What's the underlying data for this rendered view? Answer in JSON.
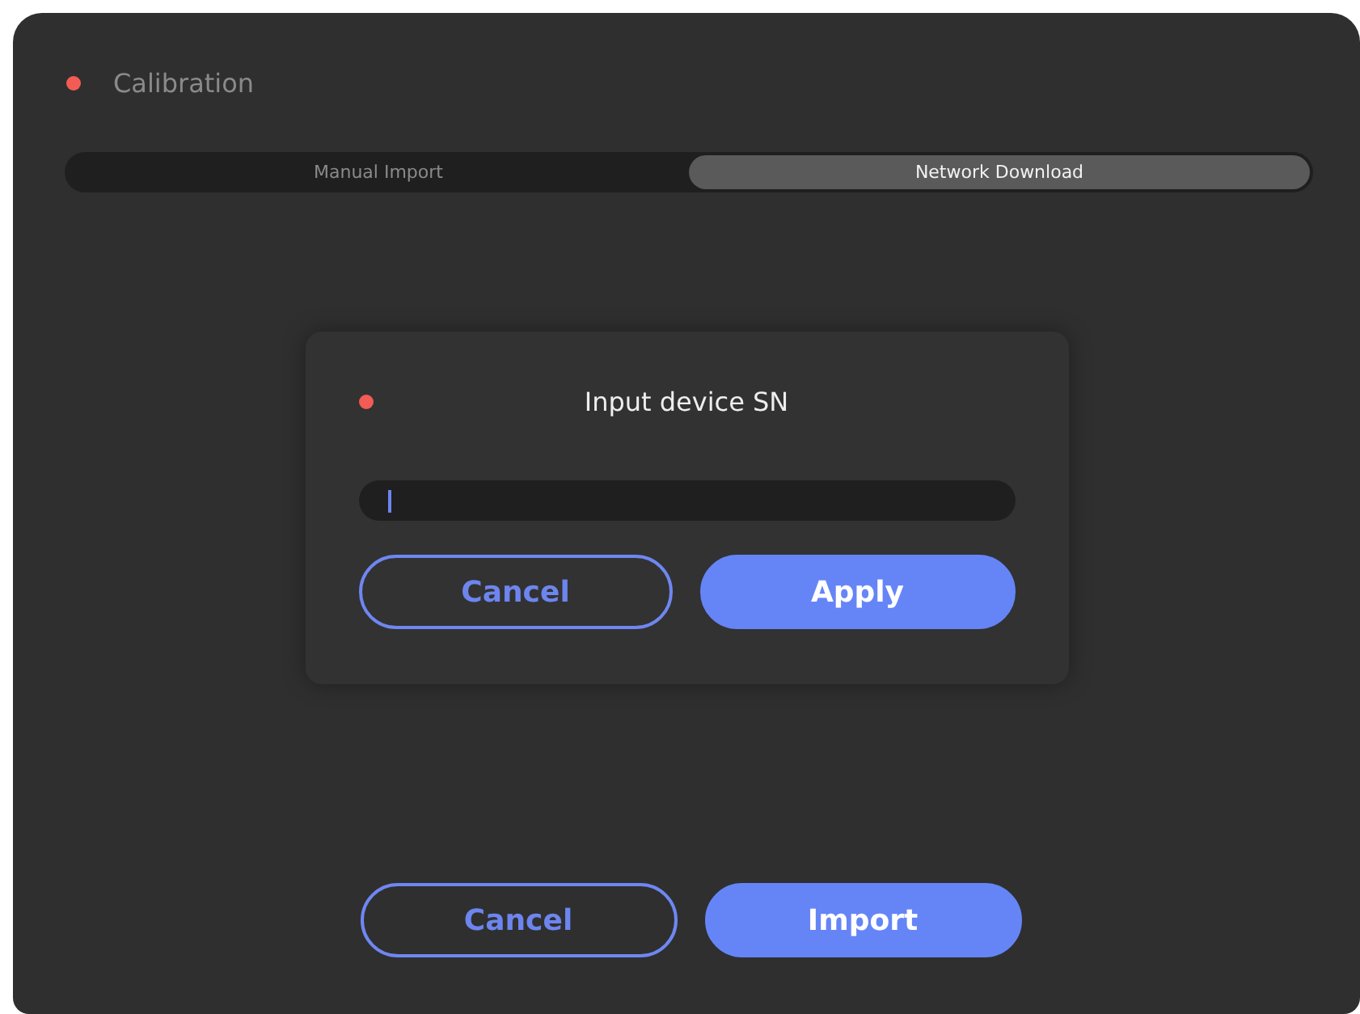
{
  "window": {
    "title": "Calibration"
  },
  "tabs": [
    {
      "label": "Manual Import",
      "selected": false
    },
    {
      "label": "Network Download",
      "selected": true
    }
  ],
  "dialog": {
    "title": "Input device SN",
    "field": {
      "focused": true
    },
    "buttons": [
      {
        "label": "Cancel",
        "kind": "secondary"
      },
      {
        "label": "Apply",
        "kind": "primary"
      }
    ]
  },
  "buttons": [
    {
      "label": "Cancel",
      "kind": "secondary"
    },
    {
      "label": "Import",
      "kind": "primary"
    }
  ]
}
